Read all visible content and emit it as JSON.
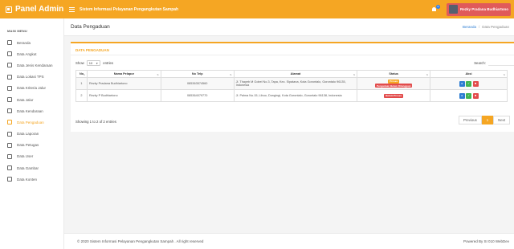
{
  "brand": {
    "name": "Panel Admin",
    "icon": "panel-logo-icon"
  },
  "header": {
    "title": "Sistem Informasi Pelayanan Pengangkutan Sampah",
    "notification_count": "0",
    "user_name": "Rezky Pradana Budhiartono"
  },
  "colors": {
    "accent": "#f5a623",
    "primary": "#2d7dd2",
    "success": "#3fb551",
    "danger": "#e24b4b"
  },
  "sidebar": {
    "heading": "MAIN MENU",
    "items": [
      {
        "label": "Beranda",
        "icon": "home-icon"
      },
      {
        "label": "Data Angkut",
        "icon": "truck-icon"
      },
      {
        "label": "Data Jenis Kendaraan",
        "icon": "car-icon"
      },
      {
        "label": "Data Lokasi TPS",
        "icon": "map-pin-icon"
      },
      {
        "label": "Data Kriteria Jalur",
        "icon": "route-icon"
      },
      {
        "label": "Data Jalur",
        "icon": "road-icon"
      },
      {
        "label": "Data Kendaraan",
        "icon": "vehicle-icon"
      },
      {
        "label": "Data Pengaduan",
        "icon": "complaint-icon",
        "active": true
      },
      {
        "label": "Data Laporan",
        "icon": "report-icon"
      },
      {
        "label": "Data Petugas",
        "icon": "staff-icon"
      },
      {
        "label": "Data User",
        "icon": "user-icon"
      },
      {
        "label": "Data Gambar",
        "icon": "image-icon"
      },
      {
        "label": "Data Konten",
        "icon": "content-icon"
      }
    ]
  },
  "page": {
    "title": "Data Pengaduan",
    "breadcrumb": {
      "home": "Beranda",
      "current": "Data Pengaduan"
    }
  },
  "card": {
    "title": "DATA PENGADUAN",
    "show_label": "Show",
    "entries_value": "10",
    "entries_label": "entries",
    "search_label": "Search:",
    "columns": [
      "No",
      "Nama Pelapor",
      "No Telp",
      "Alamat",
      "Status",
      "Aksi"
    ],
    "rows": [
      {
        "no": "1",
        "nama": "Rezky Pradana Budhiartono",
        "telp": "085363574560",
        "alamat": "Jl. Thayeb M Gobel No.3, Tapa, Kec. Sipatana, Kota Gorontalo, Gorontalo 96135, Indonesia",
        "statuses": [
          {
            "text": "Proses",
            "kind": "wait"
          },
          {
            "text": "Pengaduan Belum Ditanggapi",
            "kind": "red"
          }
        ]
      },
      {
        "no": "2",
        "nama": "Rezky P Budhiartono",
        "telp": "085364079770",
        "alamat": "Jl. Palma No.15, Libuo, Dungingi, Kota Gorontalo, Gorontalo 96138, Indonesia",
        "statuses": [
          {
            "text": "Belum Proses",
            "kind": "red"
          }
        ]
      }
    ],
    "info": "Showing 1 to 2 of 2 entries",
    "pagination": {
      "previous": "Previous",
      "current": "1",
      "next": "Next"
    }
  },
  "footer": {
    "left": "© 2020 Sistem Informasi Pelayanan Pengangkutan Sampah . All right reserved",
    "right": "Powered By SI 010 WebDev"
  }
}
